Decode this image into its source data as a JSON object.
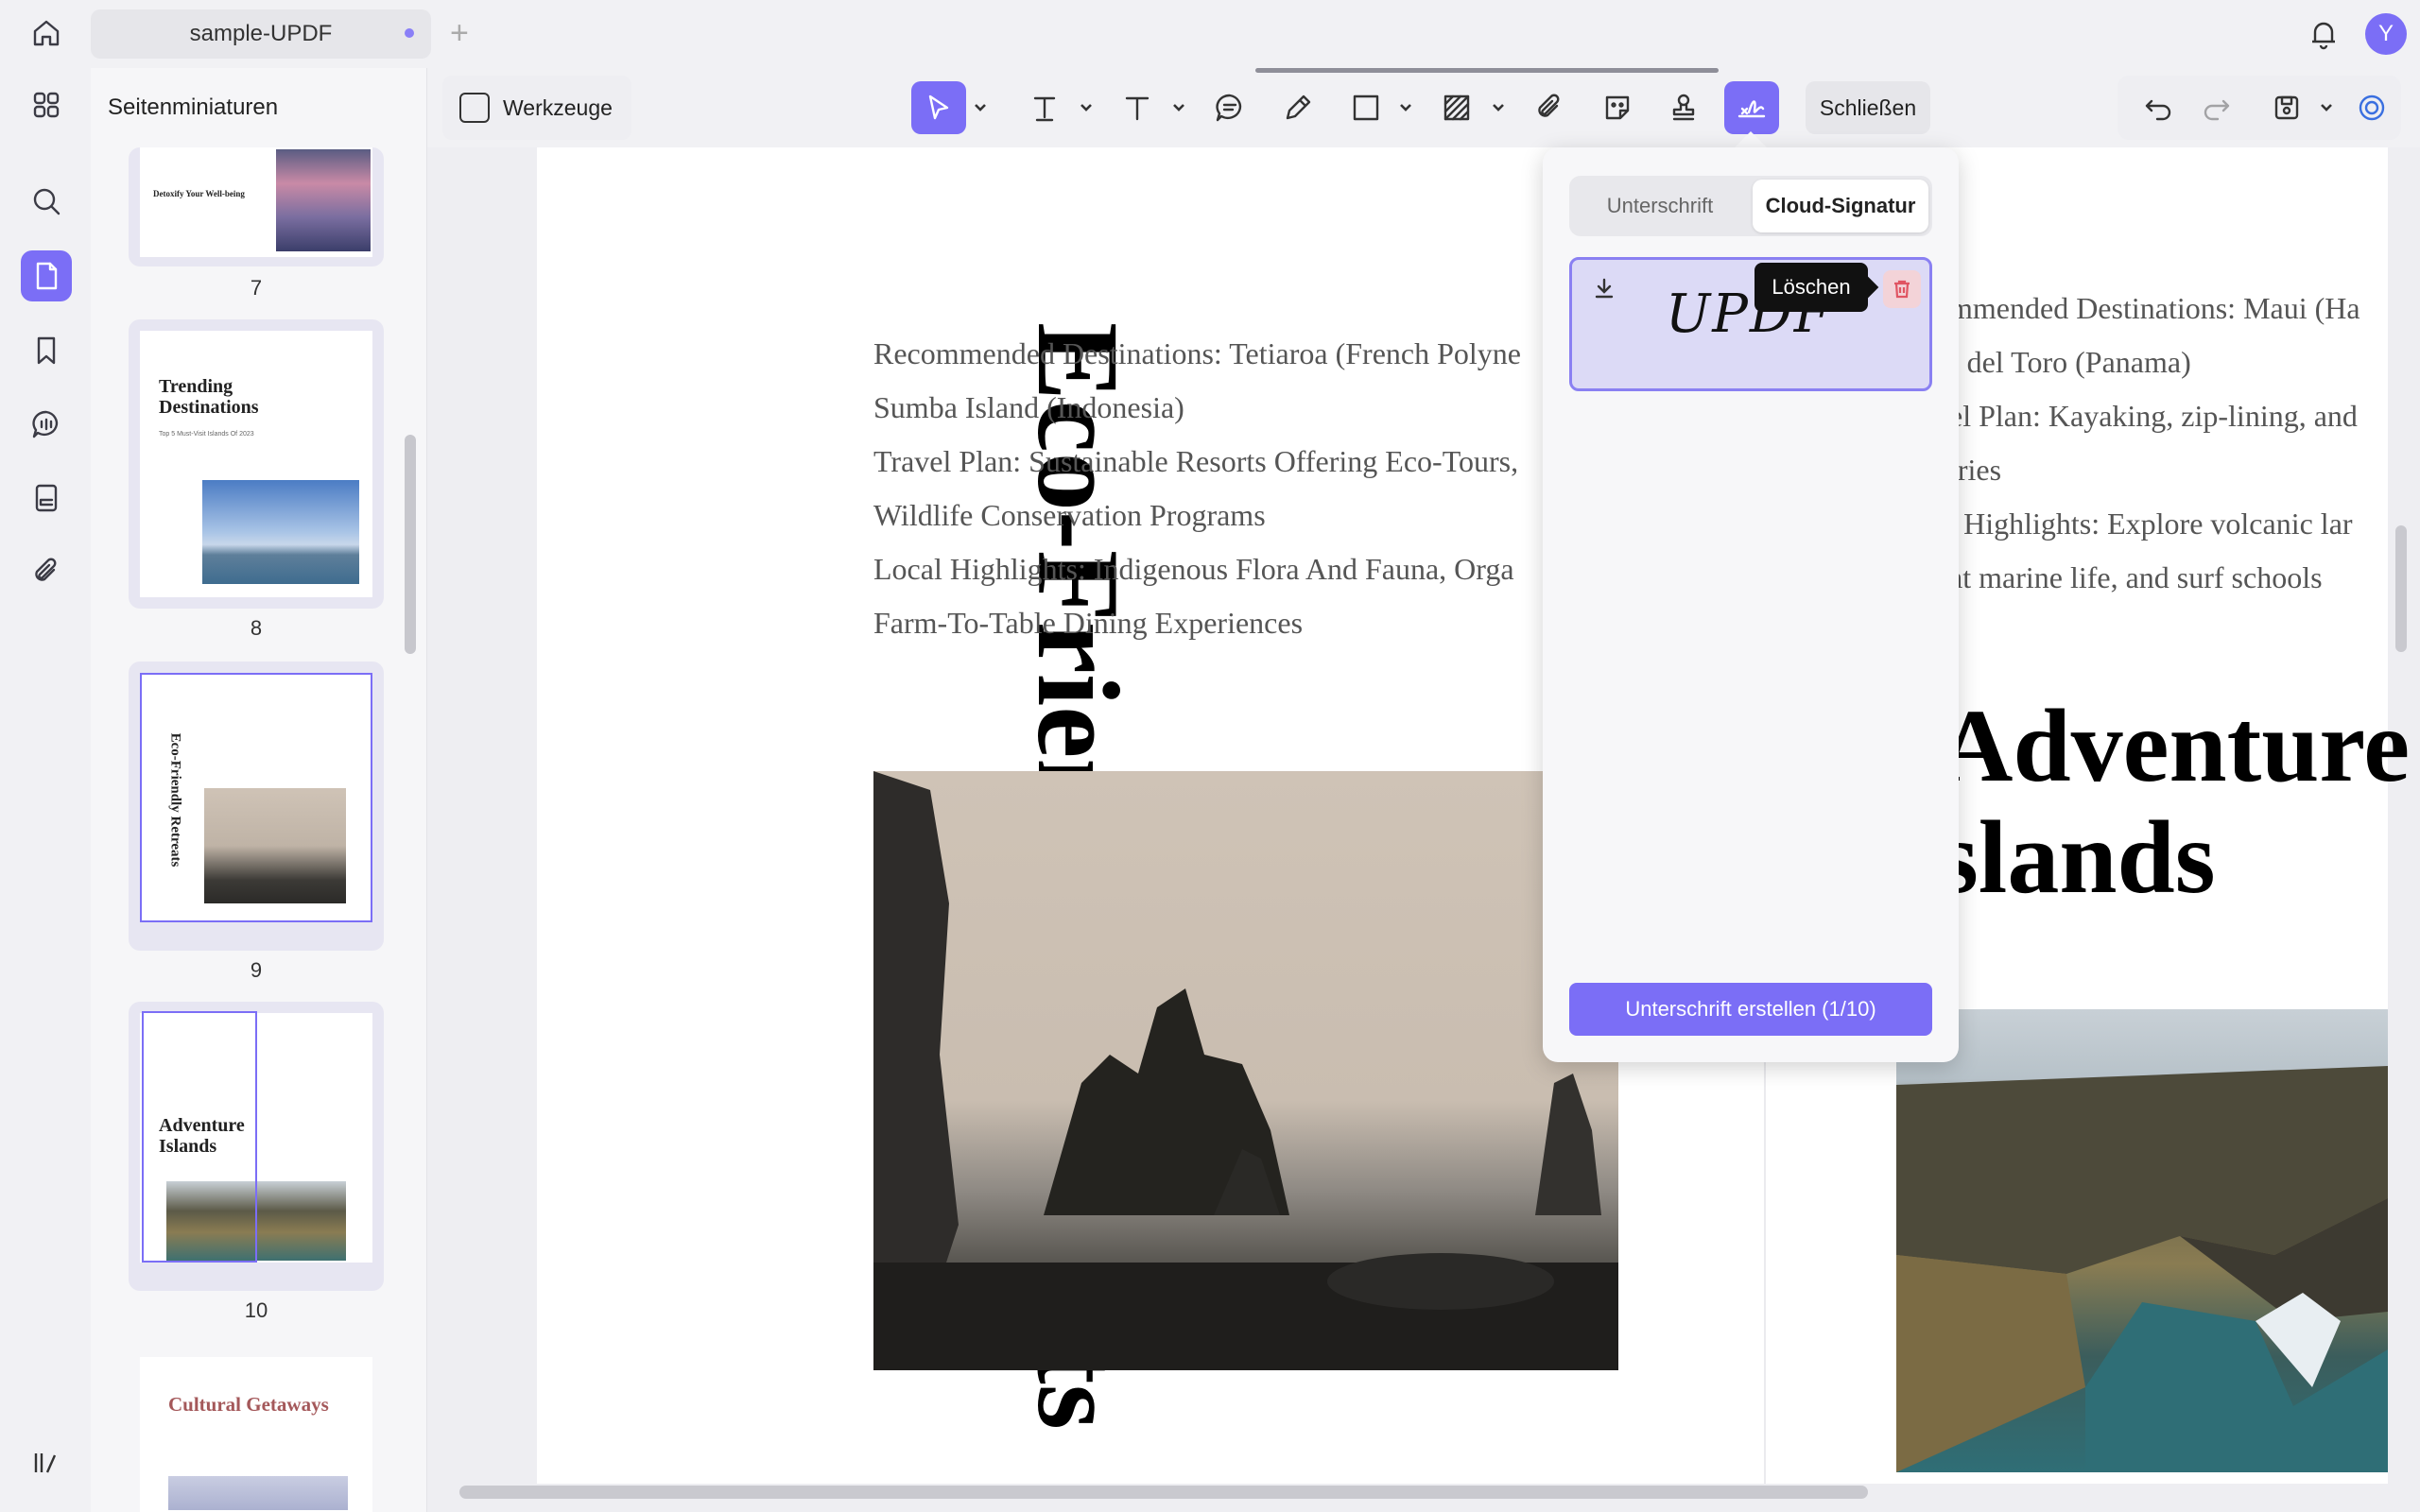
{
  "tab": {
    "title": "sample-UPDF",
    "add": "+"
  },
  "user": {
    "initial": "Y"
  },
  "thumbnails": {
    "title": "Seitenminiaturen",
    "pages": [
      {
        "number": "7",
        "heading": "Detoxify Your Well-being"
      },
      {
        "number": "8",
        "heading": "Trending Destinations",
        "subheading": "Top 5 Must-Visit Islands Of 2023"
      },
      {
        "number": "9",
        "heading": "Eco-Friendly Retreats"
      },
      {
        "number": "10",
        "heading": "Adventure Islands"
      },
      {
        "number": "",
        "heading": "Cultural Getaways"
      }
    ]
  },
  "toolbar": {
    "tools_label": "Werkzeuge",
    "close_label": "Schließen"
  },
  "document": {
    "page1": {
      "vertical_title": "Eco-Friendly Retreats",
      "lines": [
        "Recommended Destinations: Tetiaroa (French Polyne",
        "Sumba Island (Indonesia)",
        "Travel Plan: Sustainable Resorts Offering Eco-Tours,",
        "Wildlife Conservation Programs",
        "Local Highlights: Indigenous Flora And Fauna, Orga",
        "Farm-To-Table Dining Experiences"
      ]
    },
    "page2": {
      "lines": [
        "ommended Destinations: Maui (Ha",
        "as del Toro (Panama)",
        "vel Plan: Kayaking, zip-lining, and",
        "raries",
        "al Highlights: Explore volcanic lar",
        "ant marine life, and surf schools"
      ],
      "title_line1": "Adventure",
      "title_line2": "slands"
    }
  },
  "signature_panel": {
    "tab_signature": "Unterschrift",
    "tab_cloud": "Cloud-Signatur",
    "signature_text": "UPDF",
    "tooltip": "Löschen",
    "create_button": "Unterschrift erstellen (1/10)"
  },
  "colors": {
    "accent": "#7b6ef6",
    "delete": "#e05563"
  }
}
